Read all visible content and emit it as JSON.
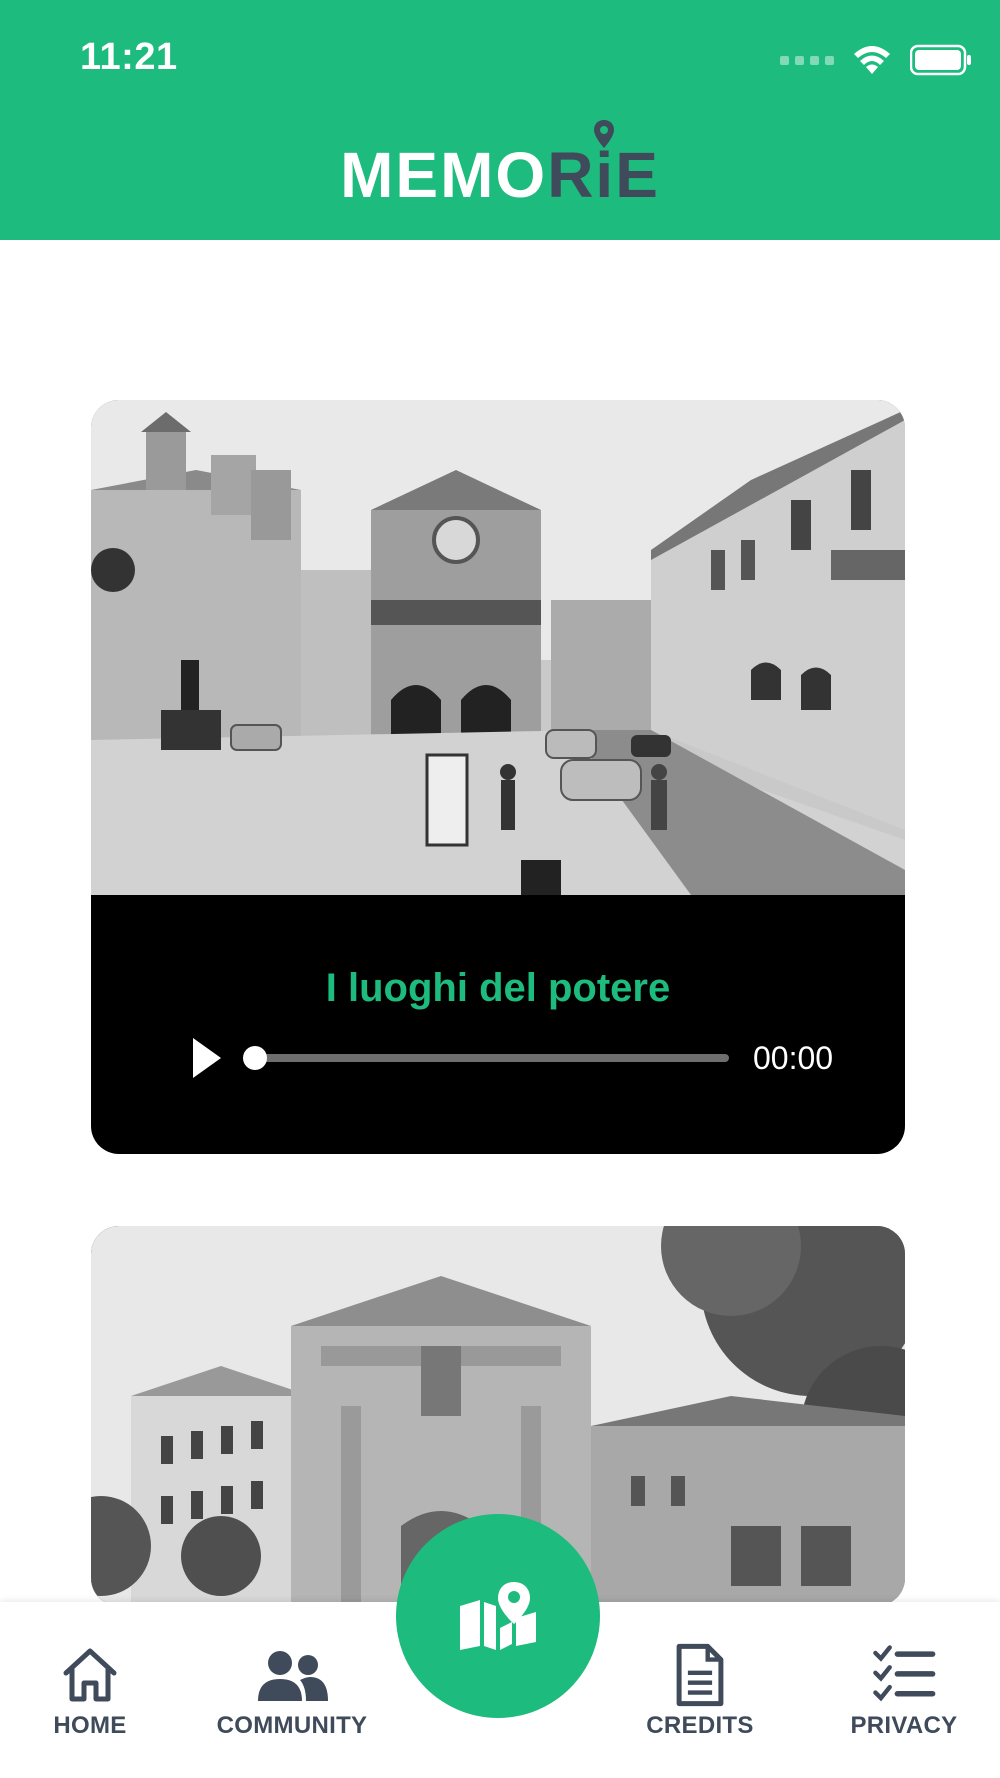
{
  "status_bar": {
    "time": "11:21"
  },
  "header": {
    "logo_part1": "MEMO",
    "logo_part2": "RiE",
    "brand_color": "#1dbb7d"
  },
  "cards": [
    {
      "title": "I luoghi del potere",
      "time": "00:00",
      "progress": 0
    },
    {
      "title": ""
    }
  ],
  "bottom_nav": {
    "items": [
      {
        "label": "HOME",
        "icon": "home-icon"
      },
      {
        "label": "COMMUNITY",
        "icon": "users-icon"
      },
      {
        "label": "CREDITS",
        "icon": "document-icon"
      },
      {
        "label": "PRIVACY",
        "icon": "checklist-icon"
      }
    ],
    "center_icon": "map-pin-icon"
  }
}
